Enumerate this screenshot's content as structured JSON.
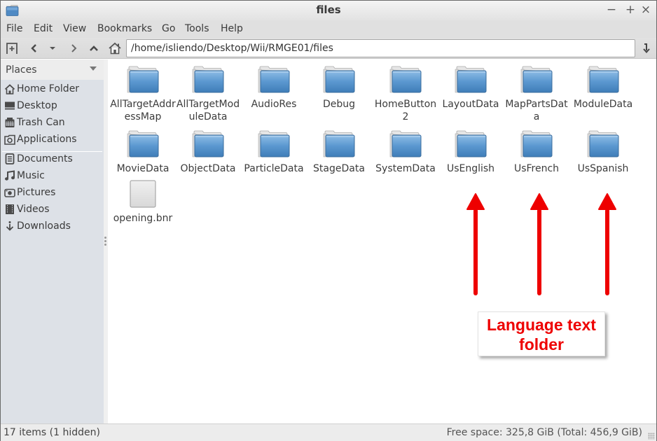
{
  "window": {
    "title": "files",
    "controls": {
      "minimize": "−",
      "maximize": "+",
      "close": "×"
    }
  },
  "menubar": {
    "items": [
      "File",
      "Edit",
      "View",
      "Bookmarks",
      "Go",
      "Tools",
      "Help"
    ]
  },
  "toolbar": {
    "new_tab_icon": "new-tab-icon",
    "back_icon": "back-icon",
    "history_icon": "history-dropdown-icon",
    "forward_icon": "forward-icon",
    "up_icon": "up-icon",
    "home_icon": "home-icon",
    "path": "/home/isliendo/Desktop/Wii/RMGE01/files",
    "go_icon": "go-icon"
  },
  "sidebar": {
    "header": "Places",
    "items": [
      {
        "label": "Home Folder",
        "icon": "home-icon"
      },
      {
        "label": "Desktop",
        "icon": "desktop-icon"
      },
      {
        "label": "Trash Can",
        "icon": "trash-icon"
      },
      {
        "label": "Applications",
        "icon": "applications-icon"
      },
      {
        "label": "Documents",
        "icon": "documents-icon"
      },
      {
        "label": "Music",
        "icon": "music-icon"
      },
      {
        "label": "Pictures",
        "icon": "pictures-icon"
      },
      {
        "label": "Videos",
        "icon": "videos-icon"
      },
      {
        "label": "Downloads",
        "icon": "downloads-icon"
      }
    ]
  },
  "files": [
    {
      "name": "AllTargetAddressMap",
      "display": "AllTargetAd\ndressMap",
      "type": "folder"
    },
    {
      "name": "AllTargetModuleData",
      "display": "AllTargetMo\nduleData",
      "type": "folder"
    },
    {
      "name": "AudioRes",
      "display": "AudioRes",
      "type": "folder"
    },
    {
      "name": "Debug",
      "display": "Debug",
      "type": "folder"
    },
    {
      "name": "HomeButton2",
      "display": "HomeButto\nn2",
      "type": "folder"
    },
    {
      "name": "LayoutData",
      "display": "LayoutData",
      "type": "folder"
    },
    {
      "name": "MapPartsData",
      "display": "MapPartsDa\nta",
      "type": "folder"
    },
    {
      "name": "ModuleData",
      "display": "ModuleData",
      "type": "folder"
    },
    {
      "name": "MovieData",
      "display": "MovieData",
      "type": "folder"
    },
    {
      "name": "ObjectData",
      "display": "ObjectData",
      "type": "folder"
    },
    {
      "name": "ParticleData",
      "display": "ParticleData",
      "type": "folder"
    },
    {
      "name": "StageData",
      "display": "StageData",
      "type": "folder"
    },
    {
      "name": "SystemData",
      "display": "SystemData",
      "type": "folder"
    },
    {
      "name": "UsEnglish",
      "display": "UsEnglish",
      "type": "folder"
    },
    {
      "name": "UsFrench",
      "display": "UsFrench",
      "type": "folder"
    },
    {
      "name": "UsSpanish",
      "display": "UsSpanish",
      "type": "folder"
    },
    {
      "name": "opening.bnr",
      "display": "opening.bnr",
      "type": "file"
    }
  ],
  "annotation": {
    "text_line1": "Language text",
    "text_line2": "folder",
    "color": "#ee0000",
    "points_to": [
      "UsEnglish",
      "UsFrench",
      "UsSpanish"
    ]
  },
  "statusbar": {
    "left": "17 items (1 hidden)",
    "right": "Free space: 325,8 GiB (Total: 456,9 GiB)"
  }
}
